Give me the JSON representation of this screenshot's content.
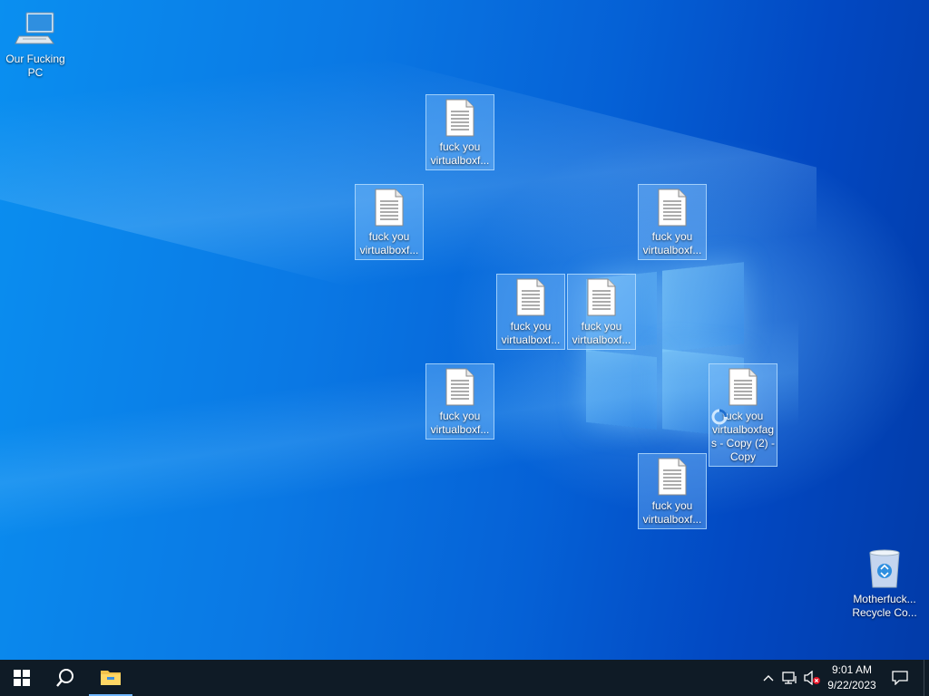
{
  "desktop_icons": {
    "pc": {
      "label_line1": "Our Fucking",
      "label_line2": "PC",
      "icon": "computer-icon"
    },
    "file1": {
      "label_line1": "fuck you",
      "label_line2": "virtualboxf...",
      "icon": "text-file-icon"
    },
    "file2": {
      "label_line1": "fuck you",
      "label_line2": "virtualboxf...",
      "icon": "text-file-icon"
    },
    "file3": {
      "label_line1": "fuck you",
      "label_line2": "virtualboxf...",
      "icon": "text-file-icon"
    },
    "file4": {
      "label_line1": "fuck you",
      "label_line2": "virtualboxf...",
      "icon": "text-file-icon"
    },
    "file5": {
      "label_line1": "fuck you",
      "label_line2": "virtualboxf...",
      "icon": "text-file-icon"
    },
    "file6": {
      "label_line1": "fuck you",
      "label_line2": "virtualboxf...",
      "icon": "text-file-icon"
    },
    "file7": {
      "label_line1": "fuck you",
      "label_line2": "virtualboxf...",
      "icon": "text-file-icon"
    },
    "file8": {
      "label_line1": "fuck you",
      "label_line2": "virtualboxfag",
      "label_line3": "s - Copy (2) -",
      "label_line4": "Copy",
      "icon": "text-file-icon"
    },
    "recycle": {
      "label_line1": "Motherfuck...",
      "label_line2": "Recycle Co...",
      "icon": "recycle-bin-icon"
    }
  },
  "taskbar": {
    "start_icon": "windows-start-icon",
    "search_icon": "search-icon",
    "explorer_icon": "file-explorer-icon",
    "tray": {
      "chevron_icon": "chevron-up-icon",
      "network_icon": "network-icon",
      "volume_icon": "volume-muted-icon",
      "time": "9:01 AM",
      "date": "9/22/2023",
      "notification_icon": "action-center-icon"
    }
  },
  "colors": {
    "desktop_blue": "#0a78e4",
    "taskbar": "#0f1b26",
    "selection": "#8cc8ff"
  }
}
